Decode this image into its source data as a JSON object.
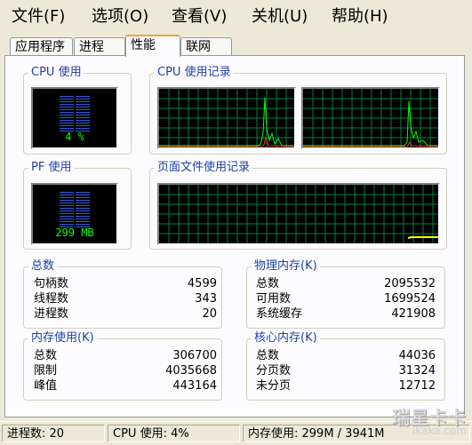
{
  "menu": [
    {
      "label": "文件(F)"
    },
    {
      "label": "选项(O)"
    },
    {
      "label": "查看(V)"
    },
    {
      "label": "关机(U)"
    },
    {
      "label": "帮助(H)"
    }
  ],
  "tabs": [
    {
      "label": "应用程序",
      "active": false
    },
    {
      "label": "进程",
      "active": false
    },
    {
      "label": "性能",
      "active": true
    },
    {
      "label": "联网",
      "active": false
    }
  ],
  "cpu_usage": {
    "title": "CPU 使用",
    "value_text": "4 %",
    "level_percent": 4
  },
  "cpu_history": {
    "title": "CPU 使用记录"
  },
  "pf_usage": {
    "title": "PF 使用",
    "value_text": "299 MB"
  },
  "pf_history": {
    "title": "页面文件使用记录"
  },
  "totals": {
    "title": "总数",
    "rows": [
      {
        "label": "句柄数",
        "value": "4599"
      },
      {
        "label": "线程数",
        "value": "343"
      },
      {
        "label": "进程数",
        "value": "20"
      }
    ]
  },
  "physical_memory": {
    "title": "物理内存(K)",
    "rows": [
      {
        "label": "总数",
        "value": "2095532"
      },
      {
        "label": "可用数",
        "value": "1699524"
      },
      {
        "label": "系统缓存",
        "value": "421908"
      }
    ]
  },
  "commit_charge": {
    "title": "内存使用(K)",
    "rows": [
      {
        "label": "总数",
        "value": "306700"
      },
      {
        "label": "限制",
        "value": "4035668"
      },
      {
        "label": "峰值",
        "value": "443164"
      }
    ]
  },
  "kernel_memory": {
    "title": "核心内存(K)",
    "rows": [
      {
        "label": "总数",
        "value": "44036"
      },
      {
        "label": "分页数",
        "value": "31324"
      },
      {
        "label": "未分页",
        "value": "12712"
      }
    ]
  },
  "statusbar": {
    "processes": "进程数: 20",
    "cpu": "CPU 使用: 4%",
    "memory": "内存使用: 299M / 3941M"
  },
  "watermark": {
    "text": "瑞星卡卡",
    "sub": "ikaka.com"
  },
  "colors": {
    "graph_line": "#00FF00",
    "graph_grid": "#008040",
    "pf_line": "#FFFF00",
    "group_title": "#1E3FA8"
  }
}
